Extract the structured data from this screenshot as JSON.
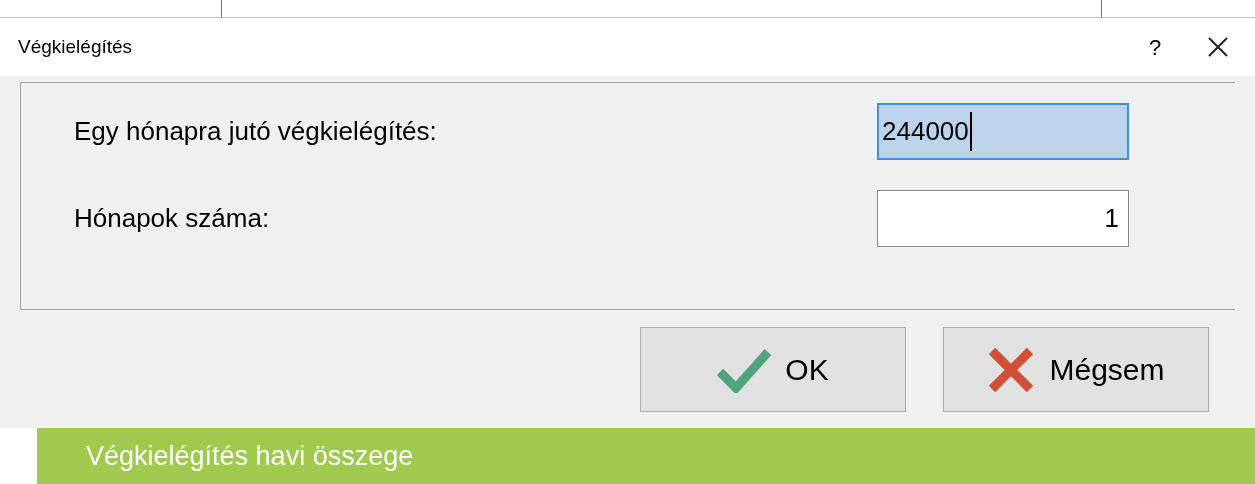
{
  "dialog": {
    "title": "Végkielégítés",
    "help": "?",
    "fields": [
      {
        "label": "Egy hónapra jutó végkielégítés:",
        "value": "244000",
        "focused": true
      },
      {
        "label": "Hónapok száma:",
        "value": "1",
        "focused": false
      }
    ],
    "buttons": [
      {
        "kind": "ok",
        "label": "OK"
      },
      {
        "kind": "cancel",
        "label": "Mégsem"
      }
    ]
  },
  "caption": "Végkielégítés havi összege"
}
